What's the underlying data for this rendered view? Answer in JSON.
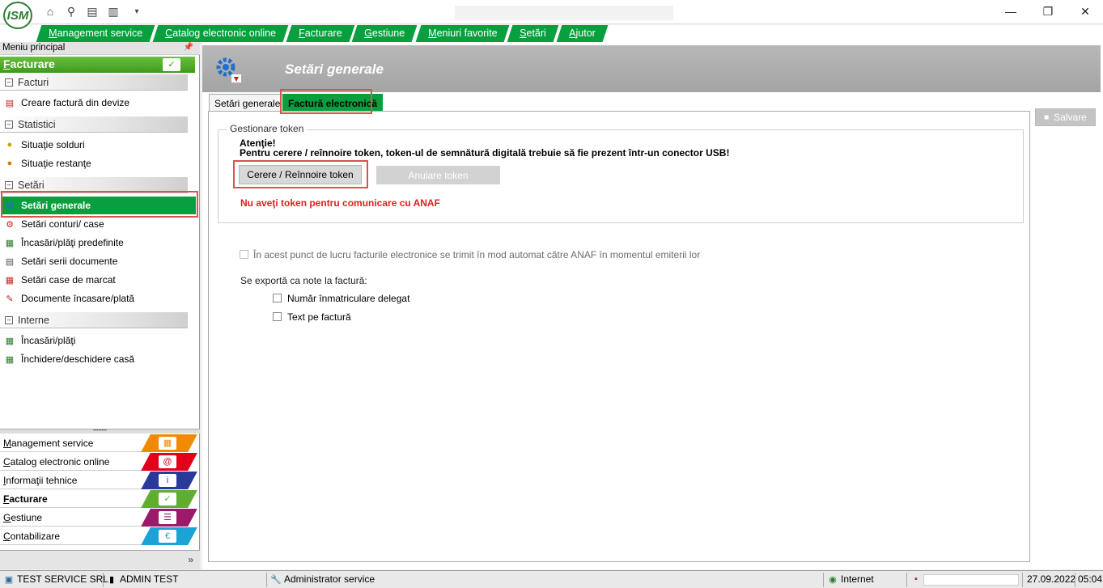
{
  "app": {
    "logo_text": "ISM"
  },
  "menu": [
    {
      "label": "Management service"
    },
    {
      "label": "Catalog electronic online"
    },
    {
      "label": "Facturare"
    },
    {
      "label": "Gestiune"
    },
    {
      "label": "Meniuri favorite"
    },
    {
      "label": "Setări"
    },
    {
      "label": "Ajutor"
    }
  ],
  "left": {
    "header": "Meniu principal",
    "module_title": "Facturare",
    "groups": {
      "facturi": "Facturi",
      "statistici": "Statistici",
      "setari": "Setări",
      "interne": "Interne"
    },
    "items": {
      "creare_factura": "Creare factură din devize",
      "situatie_solduri": "Situaţie solduri",
      "situatie_restante": "Situaţie restanţe",
      "setari_generale": "Setări generale",
      "setari_conturi": "Setări conturi/ case",
      "incasari_predefinite": "Încasări/plăţi predefinite",
      "setari_serii": "Setări serii documente",
      "setari_case": "Setări case de marcat",
      "documente_incasare": "Documente încasare/plată",
      "incasari_plati": "Încasări/plăţi",
      "inchidere_casa": "Închidere/deschidere casă"
    },
    "modules": [
      {
        "label": "Management service",
        "color": "#f08a00"
      },
      {
        "label": "Catalog electronic online",
        "color": "#e3001b"
      },
      {
        "label": "Informaţii tehnice",
        "color": "#2a3a9a"
      },
      {
        "label": "Facturare",
        "color": "#5fae2e"
      },
      {
        "label": "Gestiune",
        "color": "#9b1a6a"
      },
      {
        "label": "Contabilizare",
        "color": "#1aa3d4"
      }
    ]
  },
  "main": {
    "title": "Setări generale",
    "tabs": {
      "setari_generale": "Setări generale",
      "factura_electronica": "Factură electronică"
    },
    "save_label": "Salvare",
    "token_group": {
      "title": "Gestionare token",
      "warning_title": "Atenţie!",
      "warning_text": "Pentru cerere / reînnoire token, token-ul de semnătură digitală trebuie să fie prezent într-un conector USB!",
      "request_button": "Cerere / Reînnoire token",
      "cancel_button": "Anulare token",
      "status": "Nu aveţi token pentru comunicare cu ANAF"
    },
    "auto_send_label": "În acest punct de lucru facturile electronice se trimit în mod automat către ANAF în momentul emiterii lor",
    "export_label": "Se exportă ca note la factură:",
    "export_options": {
      "nr_inmatriculare": "Număr înmatriculare delegat",
      "text_factura": "Text pe factură"
    }
  },
  "status": {
    "company": "TEST SERVICE SRL",
    "user": "ADMIN TEST",
    "role": "Administrator service",
    "zone": "Internet",
    "date": "27.09.2022",
    "time": "05:04"
  }
}
